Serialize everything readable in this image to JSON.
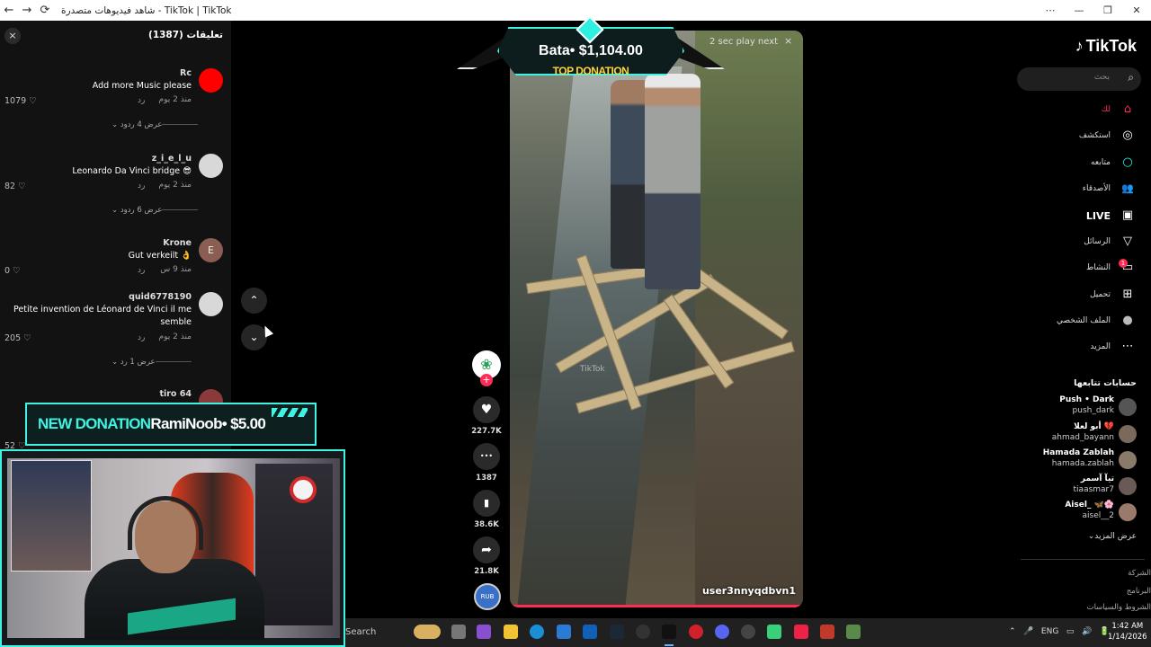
{
  "browser": {
    "title": "شاهد فيديوهات متصدرة - TikTok | TikTok",
    "back_icon": "←",
    "forward_icon": "→",
    "refresh_icon": "⟳",
    "win_controls": [
      "⋯",
      "—",
      "❐",
      "✕"
    ]
  },
  "comments_panel": {
    "title": "تعليقات (1387)",
    "close_icon": "×",
    "items": [
      {
        "user": "Rc",
        "text": "Add more Music please",
        "time": "منذ 2 يوم",
        "reply": "رد",
        "likes": "1079",
        "views": "عرض 4 ردود",
        "avatar_color": "#ff0000",
        "avatar_letter": ""
      },
      {
        "user": "z_i_e_l_u",
        "text": "Leonardo Da Vinci bridge 😎",
        "time": "منذ 2 يوم",
        "reply": "رد",
        "likes": "82",
        "views": "عرض 6 ردود",
        "avatar_color": "#d8d8d8",
        "avatar_letter": ""
      },
      {
        "user": "Krone",
        "text": "Gut verkeilt 👌",
        "time": "منذ 9 س",
        "reply": "رد",
        "likes": "0",
        "views": "",
        "avatar_color": "#8a5e52",
        "avatar_letter": "E"
      },
      {
        "user": "quid6778190",
        "text": "Petite invention de Léonard de Vinci il me semble",
        "time": "منذ 2 يوم",
        "reply": "رد",
        "likes": "205",
        "views": "عرض 1 رد",
        "avatar_color": "#d8d8d8",
        "avatar_letter": ""
      },
      {
        "user": "tiro 64",
        "text": "",
        "time": "",
        "reply": "",
        "likes": "52",
        "views": "",
        "avatar_color": "#8a3a3a",
        "avatar_letter": ""
      }
    ]
  },
  "video": {
    "nav_up_icon": "⌃",
    "nav_down_icon": "⌄",
    "play_next": "2 sec play next",
    "play_next_close": "×",
    "handle": "user3nnyqdbvn1",
    "watermark": "TikTok"
  },
  "top_donation": {
    "amount": "Bata• $1,104.00",
    "label": "TOP DONATION"
  },
  "new_donation": {
    "label": "NEW DONATION",
    "text": "RamiNoob• $5.00"
  },
  "actions": {
    "follow_icon": "+",
    "creator_icon": "❀",
    "like": {
      "icon": "♥",
      "count": "227.7K"
    },
    "comment": {
      "icon": "•••",
      "count": "1387"
    },
    "save": {
      "icon": "▮",
      "count": "38.6K"
    },
    "share": {
      "icon": "➦",
      "count": "21.8K"
    },
    "music_label": "RUB"
  },
  "sidebar": {
    "logo": "TikTok",
    "logo_icon": "♪",
    "search_placeholder": "بحث",
    "search_icon": "⌕",
    "nav": [
      {
        "label": "لك",
        "icon": "⌂",
        "active": true
      },
      {
        "label": "استكشف",
        "icon": "◎",
        "active": false
      },
      {
        "label": "متابعه",
        "icon": "○",
        "active": false
      },
      {
        "label": "الأصدقاء",
        "icon": "👥",
        "active": false
      },
      {
        "label": "LIVE",
        "icon": "▣",
        "active": false
      },
      {
        "label": "الرسائل",
        "icon": "▽",
        "active": false
      },
      {
        "label": "النشاط",
        "icon": "▭",
        "active": false
      },
      {
        "label": "تحميل",
        "icon": "⊞",
        "active": false
      },
      {
        "label": "الملف الشخصي",
        "icon": "●",
        "active": false
      },
      {
        "label": "المزيد",
        "icon": "⋯",
        "active": false
      }
    ],
    "activity_badge": "1",
    "following_title": "حسابات تتابعها",
    "following": [
      {
        "name": "Push • Dark",
        "handle": "push_dark"
      },
      {
        "name": "أبو لعلا 💔",
        "handle": "ahmad_bayann"
      },
      {
        "name": "Hamada Zablah",
        "handle": "hamada.zablah"
      },
      {
        "name": "تيآ آسمر",
        "handle": "tiaasmar7"
      },
      {
        "name": "Aisel_ 🦋🌸",
        "handle": "aisel__2"
      }
    ],
    "see_more": "عرض المزيد",
    "see_more_icon": "⌄",
    "footer": [
      "الشركة",
      "البرنامج",
      "الشروط والسياسات"
    ]
  },
  "taskbar": {
    "search_text": "Search",
    "tray_lang": "ENG",
    "time": "1:42 AM",
    "date": "1/14/2026"
  }
}
